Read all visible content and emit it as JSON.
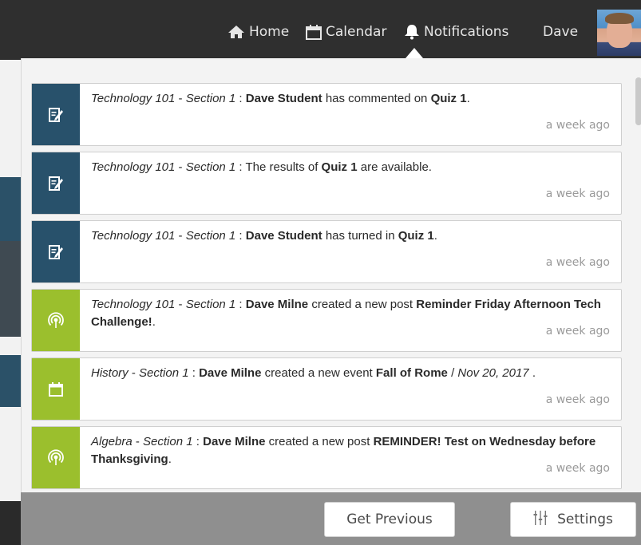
{
  "nav": {
    "home": "Home",
    "calendar": "Calendar",
    "notifications": "Notifications",
    "user": "Dave"
  },
  "notifications": [
    {
      "icon": "assignment-icon",
      "color": "#28516b",
      "course": "Technology 101",
      "section": "Section 1",
      "actor": "Dave Student",
      "action": "has commented on",
      "target": "Quiz 1",
      "suffix": ".",
      "time": "a week ago"
    },
    {
      "icon": "assignment-icon",
      "color": "#28516b",
      "course": "Technology 101",
      "section": "Section 1",
      "pre": "The results of",
      "target": "Quiz 1",
      "suffix": "are available.",
      "time": "a week ago"
    },
    {
      "icon": "assignment-icon",
      "color": "#28516b",
      "course": "Technology 101",
      "section": "Section 1",
      "actor": "Dave Student",
      "action": "has turned in",
      "target": "Quiz 1",
      "suffix": ".",
      "time": "a week ago"
    },
    {
      "icon": "broadcast-icon",
      "color": "#9bbf2d",
      "course": "Technology 101",
      "section": "Section 1",
      "actor": "Dave Milne",
      "action": "created a new post",
      "target": "Reminder Friday Afternoon Tech Challenge!",
      "suffix": ".",
      "time": "a week ago"
    },
    {
      "icon": "calendar-event-icon",
      "color": "#9bbf2d",
      "course": "History",
      "section": "Section 1",
      "actor": "Dave Milne",
      "action": "created a new event",
      "target": "Fall of Rome",
      "separator": "/",
      "date": "Nov 20, 2017",
      "suffix": ".",
      "time": "a week ago"
    },
    {
      "icon": "broadcast-icon",
      "color": "#9bbf2d",
      "course": "Algebra",
      "section": "Section 1",
      "actor": "Dave Milne",
      "action": "created a new post",
      "target": "REMINDER! Test on Wednesday before Thanksgiving",
      "suffix": ".",
      "time": "a week ago"
    }
  ],
  "footer": {
    "get_previous": "Get Previous",
    "settings": "Settings"
  }
}
